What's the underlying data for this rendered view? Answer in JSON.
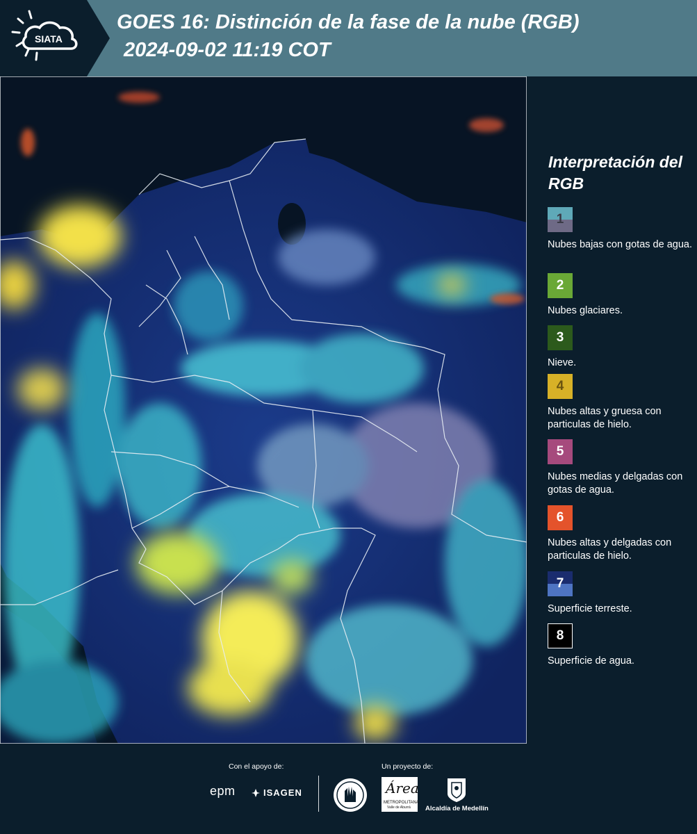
{
  "header": {
    "logo_text": "SIATA",
    "title_line1": "GOES 16: Distinción de la fase de la nube (RGB)",
    "title_line2": "2024-09-02 11:19 COT",
    "bg_color": "#507a88"
  },
  "legend": {
    "title": "Interpretación del RGB",
    "items": [
      {
        "number": "1",
        "label": "Nubes bajas con gotas de agua.",
        "color_top": "#5fa9b8",
        "color_bottom": "#6e6a86",
        "text_color": "#3a3a46"
      },
      {
        "number": "2",
        "label": "Nubes glaciares.",
        "color_top": "#6aa836",
        "color_bottom": "#6aa836",
        "text_color": "#ffffff"
      },
      {
        "number": "3",
        "label": "Nieve.",
        "color_top": "#2c5a1c",
        "color_bottom": "#2c5a1c",
        "text_color": "#ffffff"
      },
      {
        "number": "4",
        "label": "Nubes altas y gruesa con particulas de hielo.",
        "color_top": "#d7b127",
        "color_bottom": "#d7b127",
        "text_color": "#6a5410"
      },
      {
        "number": "5",
        "label": "Nubes medias y delgadas con gotas de agua.",
        "color_top": "#a64a7d",
        "color_bottom": "#a64a7d",
        "text_color": "#ffffff"
      },
      {
        "number": "6",
        "label": "Nubes altas y delgadas con particulas de hielo.",
        "color_top": "#e4532b",
        "color_bottom": "#e4532b",
        "text_color": "#ffffff"
      },
      {
        "number": "7",
        "label": "Superficie terreste.",
        "color_top": "#1a2c6e",
        "color_bottom": "#4e74c2",
        "text_color": "#ffffff"
      },
      {
        "number": "8",
        "label": "Superficie de agua.",
        "color_top": "#000000",
        "color_bottom": "#000000",
        "text_color": "#ffffff"
      }
    ]
  },
  "footer": {
    "support_caption": "Con el apoyo de:",
    "project_caption": "Un proyecto de:",
    "epm": "epm",
    "isagen": "ISAGEN",
    "area_logo_main": "Área",
    "area_logo_line1": "METROPOLITANA",
    "area_logo_line2": "Valle de Aburrá",
    "medellin": "Alcaldía de Medellín"
  }
}
